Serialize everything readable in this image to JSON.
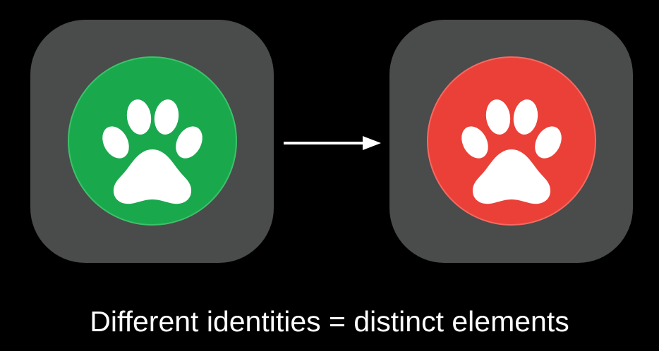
{
  "caption": "Different identities = distinct elements",
  "tiles": [
    {
      "state": "before",
      "icon": "paw-icon",
      "circle_color": "#1aa84d",
      "circle_border": "#3cc26a"
    },
    {
      "state": "after",
      "icon": "paw-icon",
      "circle_color": "#ea4038",
      "circle_border": "#f46a62"
    }
  ],
  "colors": {
    "background": "#000000",
    "tile": "#4a4b4b",
    "paw": "#ffffff",
    "arrow": "#ffffff",
    "caption": "#ffffff"
  },
  "connector_icon": "arrow-right-icon"
}
